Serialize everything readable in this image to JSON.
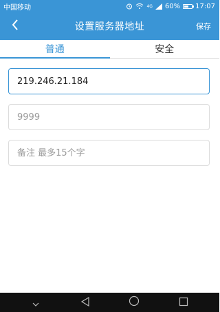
{
  "status_bar": {
    "carrier": "中国移动",
    "network": "4G",
    "battery_percent": "60%",
    "battery_level": 0.6,
    "time": "17:07",
    "icons": [
      "alarm-icon",
      "wifi-icon",
      "signal-icon",
      "battery-icon"
    ]
  },
  "header": {
    "title": "设置服务器地址",
    "back_icon": "back-arrow-icon",
    "save_label": "保存"
  },
  "tabs": [
    {
      "label": "普通",
      "active": true
    },
    {
      "label": "安全",
      "active": false
    }
  ],
  "form": {
    "ip": {
      "value": "219.246.21.184",
      "placeholder": ""
    },
    "port": {
      "value": "",
      "placeholder": "9999"
    },
    "note": {
      "value": "",
      "placeholder": "备注 最多15个字"
    }
  },
  "nav_bar": {
    "icons": [
      "nav-down-icon",
      "nav-back-icon",
      "nav-home-icon",
      "nav-recents-icon"
    ]
  },
  "colors": {
    "accent": "#3a95d6",
    "nav_bar": "#111111"
  }
}
